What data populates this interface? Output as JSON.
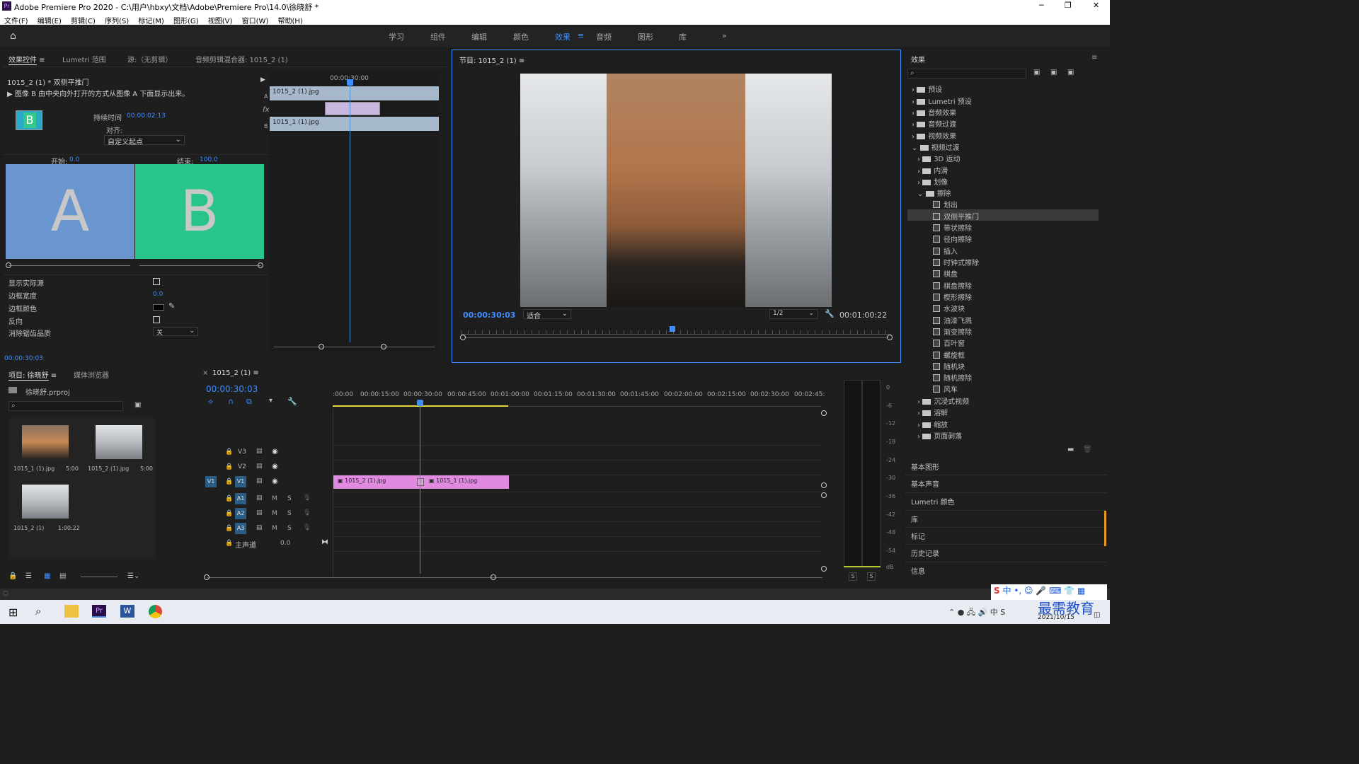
{
  "window": {
    "title": "Adobe Premiere Pro 2020 - C:\\用户\\hbxy\\文档\\Adobe\\Premiere Pro\\14.0\\徐晓舒 *",
    "minimize": "─",
    "restore": "❐",
    "close": "✕"
  },
  "menu": [
    "文件(F)",
    "编辑(E)",
    "剪辑(C)",
    "序列(S)",
    "标记(M)",
    "图形(G)",
    "视图(V)",
    "窗口(W)",
    "帮助(H)"
  ],
  "workspaces": [
    "学习",
    "组件",
    "编辑",
    "颜色",
    "效果",
    "音频",
    "图形",
    "库"
  ],
  "effect_controls": {
    "tabs": [
      "效果控件",
      "Lumetri 范围",
      "源:（无剪辑）",
      "音频剪辑混合器: 1015_2 (1)"
    ],
    "clip_title": "1015_2 (1) * 双侧平推门",
    "description": "图像 B 由中央向外打开的方式从图像 A 下面显示出来。",
    "thumb_letter": "B",
    "duration_label": "持续时间",
    "duration_value": "00:00:02:13",
    "align_label": "对齐:",
    "align_value": "自定义起点",
    "start_label": "开始:",
    "start_value": "0.0",
    "end_label": "结束:",
    "end_value": "100.0",
    "a_label": "A",
    "b_label": "B",
    "props": [
      {
        "label": "显示实际源"
      },
      {
        "label": "边框宽度",
        "value": "0.0"
      },
      {
        "label": "边框颜色"
      },
      {
        "label": "反向"
      },
      {
        "label": "消除锯齿品质",
        "value": "关"
      }
    ],
    "timecode": "00:00:30:03",
    "mini_ruler": "00:00:30:00",
    "mini_clip_a": "1015_2 (1).jpg",
    "mini_clip_b": "1015_1 (1).jpg",
    "track_a": "A",
    "track_b": "B",
    "fx": "fx"
  },
  "program": {
    "title": "节目: 1015_2 (1)",
    "timecode": "00:00:30:03",
    "fit": "适合",
    "resolution": "1/2",
    "duration": "00:01:00:22"
  },
  "project": {
    "tabs": [
      "项目: 徐晓舒",
      "媒体浏览器"
    ],
    "file": "徐晓舒.prproj",
    "items": [
      {
        "name": "1015_1 (1).jpg",
        "dur": "5:00"
      },
      {
        "name": "1015_2 (1).jpg",
        "dur": "5:00"
      },
      {
        "name": "1015_2 (1)",
        "dur": "1:00:22"
      }
    ]
  },
  "timeline": {
    "tab": "1015_2 (1)",
    "timecode": "00:00:30:03",
    "ruler": [
      ":00:00",
      "00:00:15:00",
      "00:00:30:00",
      "00:00:45:00",
      "00:01:00:00",
      "00:01:15:00",
      "00:01:30:00",
      "00:01:45:00",
      "00:02:00:00",
      "00:02:15:00",
      "00:02:30:00",
      "00:02:45:"
    ],
    "tracks": [
      "V3",
      "V2",
      "V1",
      "A1",
      "A2",
      "A3"
    ],
    "v1_src": "V1",
    "master": "主声道",
    "master_val": "0.0",
    "m": "M",
    "s": "S",
    "clip1": "1015_2 (1).jpg",
    "clip2": "1015_1 (1).jpg"
  },
  "meter": {
    "ticks": [
      "0",
      "-6",
      "-12",
      "-18",
      "-24",
      "-30",
      "-36",
      "-42",
      "-48",
      "-54",
      "dB"
    ],
    "s": "S"
  },
  "effects_panel": {
    "title": "效果",
    "top": [
      "预设",
      "Lumetri 预设",
      "音频效果",
      "音频过渡",
      "视频效果",
      "视频过渡"
    ],
    "sub": [
      "3D 运动",
      "内滑",
      "划像",
      "擦除"
    ],
    "wipes": [
      "划出",
      "双侧平推门",
      "带状擦除",
      "径向擦除",
      "插入",
      "时钟式擦除",
      "棋盘",
      "棋盘擦除",
      "楔形擦除",
      "水波块",
      "油漆飞溅",
      "渐变擦除",
      "百叶窗",
      "螺旋框",
      "随机块",
      "随机擦除",
      "风车"
    ],
    "after": [
      "沉浸式视频",
      "溶解",
      "缩放",
      "页面剥落"
    ]
  },
  "right_panels": [
    "基本图形",
    "基本声音",
    "Lumetri 颜色",
    "库",
    "标记",
    "历史记录",
    "信息"
  ],
  "taskbar": {
    "date": "2021/10/15",
    "watermark": "最需教育",
    "ime": "中"
  }
}
